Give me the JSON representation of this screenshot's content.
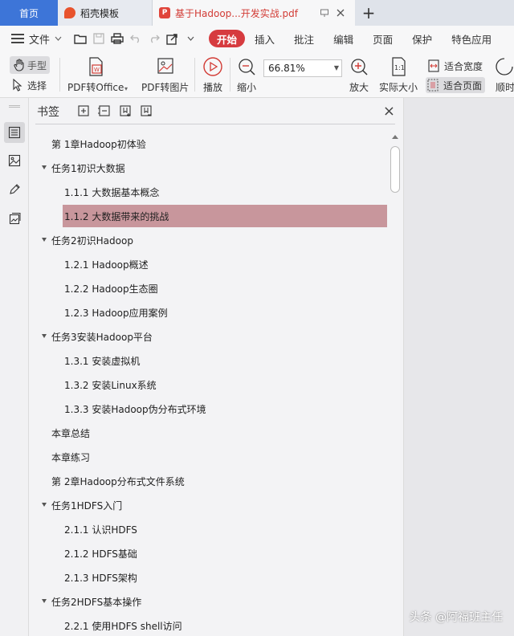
{
  "tabs": {
    "home": "首页",
    "template": "稻壳模板",
    "document": "基于Hadoop...开发实战.pdf",
    "add_symbol": "+"
  },
  "menubar": {
    "file": "文件",
    "items": [
      "开始",
      "插入",
      "批注",
      "编辑",
      "页面",
      "保护",
      "特色应用"
    ],
    "active_item": "开始"
  },
  "ribbon": {
    "hand": "手型",
    "select": "选择",
    "pdf_to_office": "PDF转Office",
    "pdf_to_image": "PDF转图片",
    "play": "播放",
    "zoom_out": "缩小",
    "zoom_value": "66.81%",
    "zoom_in": "放大",
    "actual_size": "实际大小",
    "fit_width": "适合宽度",
    "fit_page": "适合页面",
    "rotate_partial": "顺时"
  },
  "panel": {
    "title": "书签",
    "close_symbol": "×"
  },
  "bookmarks": [
    {
      "label": "第 1章Hadoop初体验",
      "level": 0,
      "expandable": false
    },
    {
      "label": "任务1初识大数据",
      "level": 0,
      "expandable": true
    },
    {
      "label": "1.1.1 大数据基本概念",
      "level": 1
    },
    {
      "label": "1.1.2 大数据带来的挑战",
      "level": 1,
      "selected": true
    },
    {
      "label": "任务2初识Hadoop",
      "level": 0,
      "expandable": true
    },
    {
      "label": "1.2.1 Hadoop概述",
      "level": 1
    },
    {
      "label": "1.2.2 Hadoop生态圈",
      "level": 1
    },
    {
      "label": "1.2.3 Hadoop应用案例",
      "level": 1
    },
    {
      "label": "任务3安装Hadoop平台",
      "level": 0,
      "expandable": true
    },
    {
      "label": "1.3.1 安装虚拟机",
      "level": 1
    },
    {
      "label": "1.3.2 安装Linux系统",
      "level": 1
    },
    {
      "label": "1.3.3 安装Hadoop伪分布式环境",
      "level": 1
    },
    {
      "label": "本章总结",
      "level": 0,
      "expandable": false
    },
    {
      "label": "本章练习",
      "level": 0,
      "expandable": false
    },
    {
      "label": "第 2章Hadoop分布式文件系统",
      "level": 0,
      "expandable": false
    },
    {
      "label": "任务1HDFS入门",
      "level": 0,
      "expandable": true
    },
    {
      "label": "2.1.1 认识HDFS",
      "level": 1
    },
    {
      "label": "2.1.2 HDFS基础",
      "level": 1
    },
    {
      "label": "2.1.3 HDFS架构",
      "level": 1
    },
    {
      "label": "任务2HDFS基本操作",
      "level": 0,
      "expandable": true
    },
    {
      "label": "2.2.1 使用HDFS shell访问",
      "level": 1
    }
  ],
  "watermark": "头条 @阿福班主任",
  "colors": {
    "home_tab": "#3d75d8",
    "active_menu": "#d63b3f",
    "selected_bookmark": "#c8969c",
    "doc_tab_text": "#d23b35"
  }
}
